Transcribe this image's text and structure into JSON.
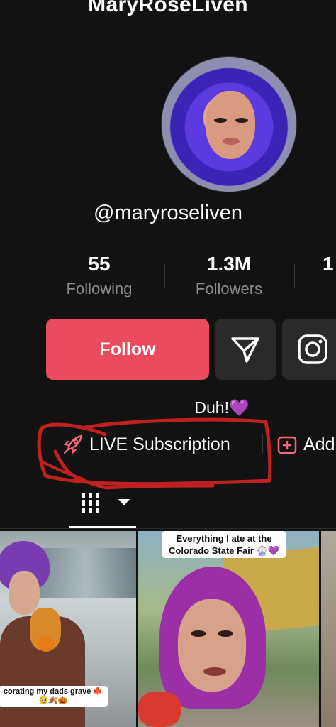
{
  "profile": {
    "display_name": "MaryRoseLiven",
    "handle": "@maryroseliven",
    "bio": "Duh!💜"
  },
  "stats": [
    {
      "value": "55",
      "label": "Following"
    },
    {
      "value": "1.3M",
      "label": "Followers"
    },
    {
      "value": "1",
      "label": ""
    }
  ],
  "actions": {
    "follow_label": "Follow",
    "message_icon": "send-icon",
    "instagram_icon": "instagram-icon"
  },
  "links": {
    "live_label": "LIVE Subscription",
    "add_label": "Add"
  },
  "tabs": {
    "grid_icon": "videos-grid-icon",
    "dropdown_icon": "caret-down-icon"
  },
  "videos": [
    {
      "caption": "corating my dads grave 🍁",
      "caption2": "🥹🍂🎃"
    },
    {
      "caption": "Everything I ate at the",
      "caption2": "Colorado State Fair 🎡💜"
    }
  ],
  "colors": {
    "background": "#121212",
    "follow": "#ea4c5e",
    "annotation": "#c0201f"
  }
}
